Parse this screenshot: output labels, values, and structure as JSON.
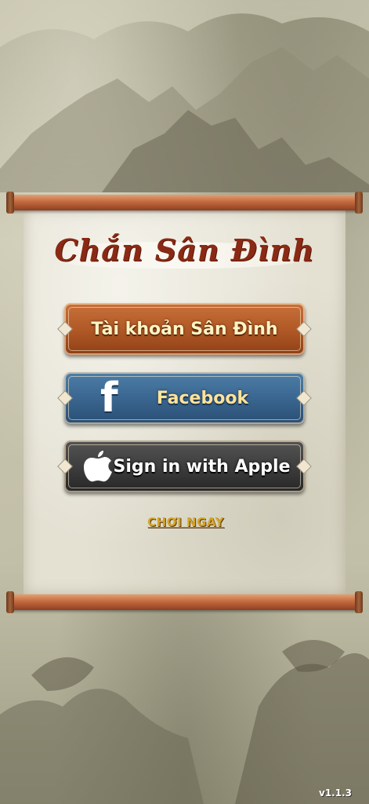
{
  "title": "Chắn Sân Đình",
  "buttons": {
    "account": "Tài khoản Sân Đình",
    "facebook": "Facebook",
    "apple": "Sign in with Apple"
  },
  "play_now": "CHƠI NGAY",
  "version": "v1.1.3",
  "icons": {
    "facebook": "facebook-icon",
    "apple": "apple-icon"
  },
  "colors": {
    "title": "#8a2a14",
    "account_button": "#b25a27",
    "facebook_button": "#3a6690",
    "apple_button": "#3e3e3e",
    "play_now": "#d4a42a"
  }
}
